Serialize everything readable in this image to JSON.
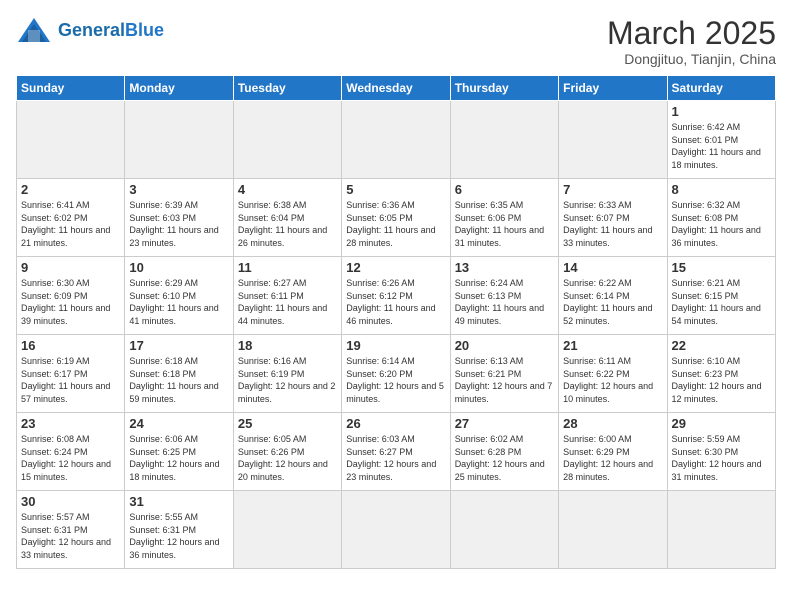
{
  "header": {
    "logo_text_normal": "General",
    "logo_text_bold": "Blue",
    "month_title": "March 2025",
    "location": "Dongjituo, Tianjin, China"
  },
  "weekdays": [
    "Sunday",
    "Monday",
    "Tuesday",
    "Wednesday",
    "Thursday",
    "Friday",
    "Saturday"
  ],
  "weeks": [
    [
      {
        "day": "",
        "info": ""
      },
      {
        "day": "",
        "info": ""
      },
      {
        "day": "",
        "info": ""
      },
      {
        "day": "",
        "info": ""
      },
      {
        "day": "",
        "info": ""
      },
      {
        "day": "",
        "info": ""
      },
      {
        "day": "1",
        "info": "Sunrise: 6:42 AM\nSunset: 6:01 PM\nDaylight: 11 hours\nand 18 minutes."
      }
    ],
    [
      {
        "day": "2",
        "info": "Sunrise: 6:41 AM\nSunset: 6:02 PM\nDaylight: 11 hours\nand 21 minutes."
      },
      {
        "day": "3",
        "info": "Sunrise: 6:39 AM\nSunset: 6:03 PM\nDaylight: 11 hours\nand 23 minutes."
      },
      {
        "day": "4",
        "info": "Sunrise: 6:38 AM\nSunset: 6:04 PM\nDaylight: 11 hours\nand 26 minutes."
      },
      {
        "day": "5",
        "info": "Sunrise: 6:36 AM\nSunset: 6:05 PM\nDaylight: 11 hours\nand 28 minutes."
      },
      {
        "day": "6",
        "info": "Sunrise: 6:35 AM\nSunset: 6:06 PM\nDaylight: 11 hours\nand 31 minutes."
      },
      {
        "day": "7",
        "info": "Sunrise: 6:33 AM\nSunset: 6:07 PM\nDaylight: 11 hours\nand 33 minutes."
      },
      {
        "day": "8",
        "info": "Sunrise: 6:32 AM\nSunset: 6:08 PM\nDaylight: 11 hours\nand 36 minutes."
      }
    ],
    [
      {
        "day": "9",
        "info": "Sunrise: 6:30 AM\nSunset: 6:09 PM\nDaylight: 11 hours\nand 39 minutes."
      },
      {
        "day": "10",
        "info": "Sunrise: 6:29 AM\nSunset: 6:10 PM\nDaylight: 11 hours\nand 41 minutes."
      },
      {
        "day": "11",
        "info": "Sunrise: 6:27 AM\nSunset: 6:11 PM\nDaylight: 11 hours\nand 44 minutes."
      },
      {
        "day": "12",
        "info": "Sunrise: 6:26 AM\nSunset: 6:12 PM\nDaylight: 11 hours\nand 46 minutes."
      },
      {
        "day": "13",
        "info": "Sunrise: 6:24 AM\nSunset: 6:13 PM\nDaylight: 11 hours\nand 49 minutes."
      },
      {
        "day": "14",
        "info": "Sunrise: 6:22 AM\nSunset: 6:14 PM\nDaylight: 11 hours\nand 52 minutes."
      },
      {
        "day": "15",
        "info": "Sunrise: 6:21 AM\nSunset: 6:15 PM\nDaylight: 11 hours\nand 54 minutes."
      }
    ],
    [
      {
        "day": "16",
        "info": "Sunrise: 6:19 AM\nSunset: 6:17 PM\nDaylight: 11 hours\nand 57 minutes."
      },
      {
        "day": "17",
        "info": "Sunrise: 6:18 AM\nSunset: 6:18 PM\nDaylight: 11 hours\nand 59 minutes."
      },
      {
        "day": "18",
        "info": "Sunrise: 6:16 AM\nSunset: 6:19 PM\nDaylight: 12 hours\nand 2 minutes."
      },
      {
        "day": "19",
        "info": "Sunrise: 6:14 AM\nSunset: 6:20 PM\nDaylight: 12 hours\nand 5 minutes."
      },
      {
        "day": "20",
        "info": "Sunrise: 6:13 AM\nSunset: 6:21 PM\nDaylight: 12 hours\nand 7 minutes."
      },
      {
        "day": "21",
        "info": "Sunrise: 6:11 AM\nSunset: 6:22 PM\nDaylight: 12 hours\nand 10 minutes."
      },
      {
        "day": "22",
        "info": "Sunrise: 6:10 AM\nSunset: 6:23 PM\nDaylight: 12 hours\nand 12 minutes."
      }
    ],
    [
      {
        "day": "23",
        "info": "Sunrise: 6:08 AM\nSunset: 6:24 PM\nDaylight: 12 hours\nand 15 minutes."
      },
      {
        "day": "24",
        "info": "Sunrise: 6:06 AM\nSunset: 6:25 PM\nDaylight: 12 hours\nand 18 minutes."
      },
      {
        "day": "25",
        "info": "Sunrise: 6:05 AM\nSunset: 6:26 PM\nDaylight: 12 hours\nand 20 minutes."
      },
      {
        "day": "26",
        "info": "Sunrise: 6:03 AM\nSunset: 6:27 PM\nDaylight: 12 hours\nand 23 minutes."
      },
      {
        "day": "27",
        "info": "Sunrise: 6:02 AM\nSunset: 6:28 PM\nDaylight: 12 hours\nand 25 minutes."
      },
      {
        "day": "28",
        "info": "Sunrise: 6:00 AM\nSunset: 6:29 PM\nDaylight: 12 hours\nand 28 minutes."
      },
      {
        "day": "29",
        "info": "Sunrise: 5:59 AM\nSunset: 6:30 PM\nDaylight: 12 hours\nand 31 minutes."
      }
    ],
    [
      {
        "day": "30",
        "info": "Sunrise: 5:57 AM\nSunset: 6:31 PM\nDaylight: 12 hours\nand 33 minutes."
      },
      {
        "day": "31",
        "info": "Sunrise: 5:55 AM\nSunset: 6:31 PM\nDaylight: 12 hours\nand 36 minutes."
      },
      {
        "day": "",
        "info": ""
      },
      {
        "day": "",
        "info": ""
      },
      {
        "day": "",
        "info": ""
      },
      {
        "day": "",
        "info": ""
      },
      {
        "day": "",
        "info": ""
      }
    ]
  ]
}
